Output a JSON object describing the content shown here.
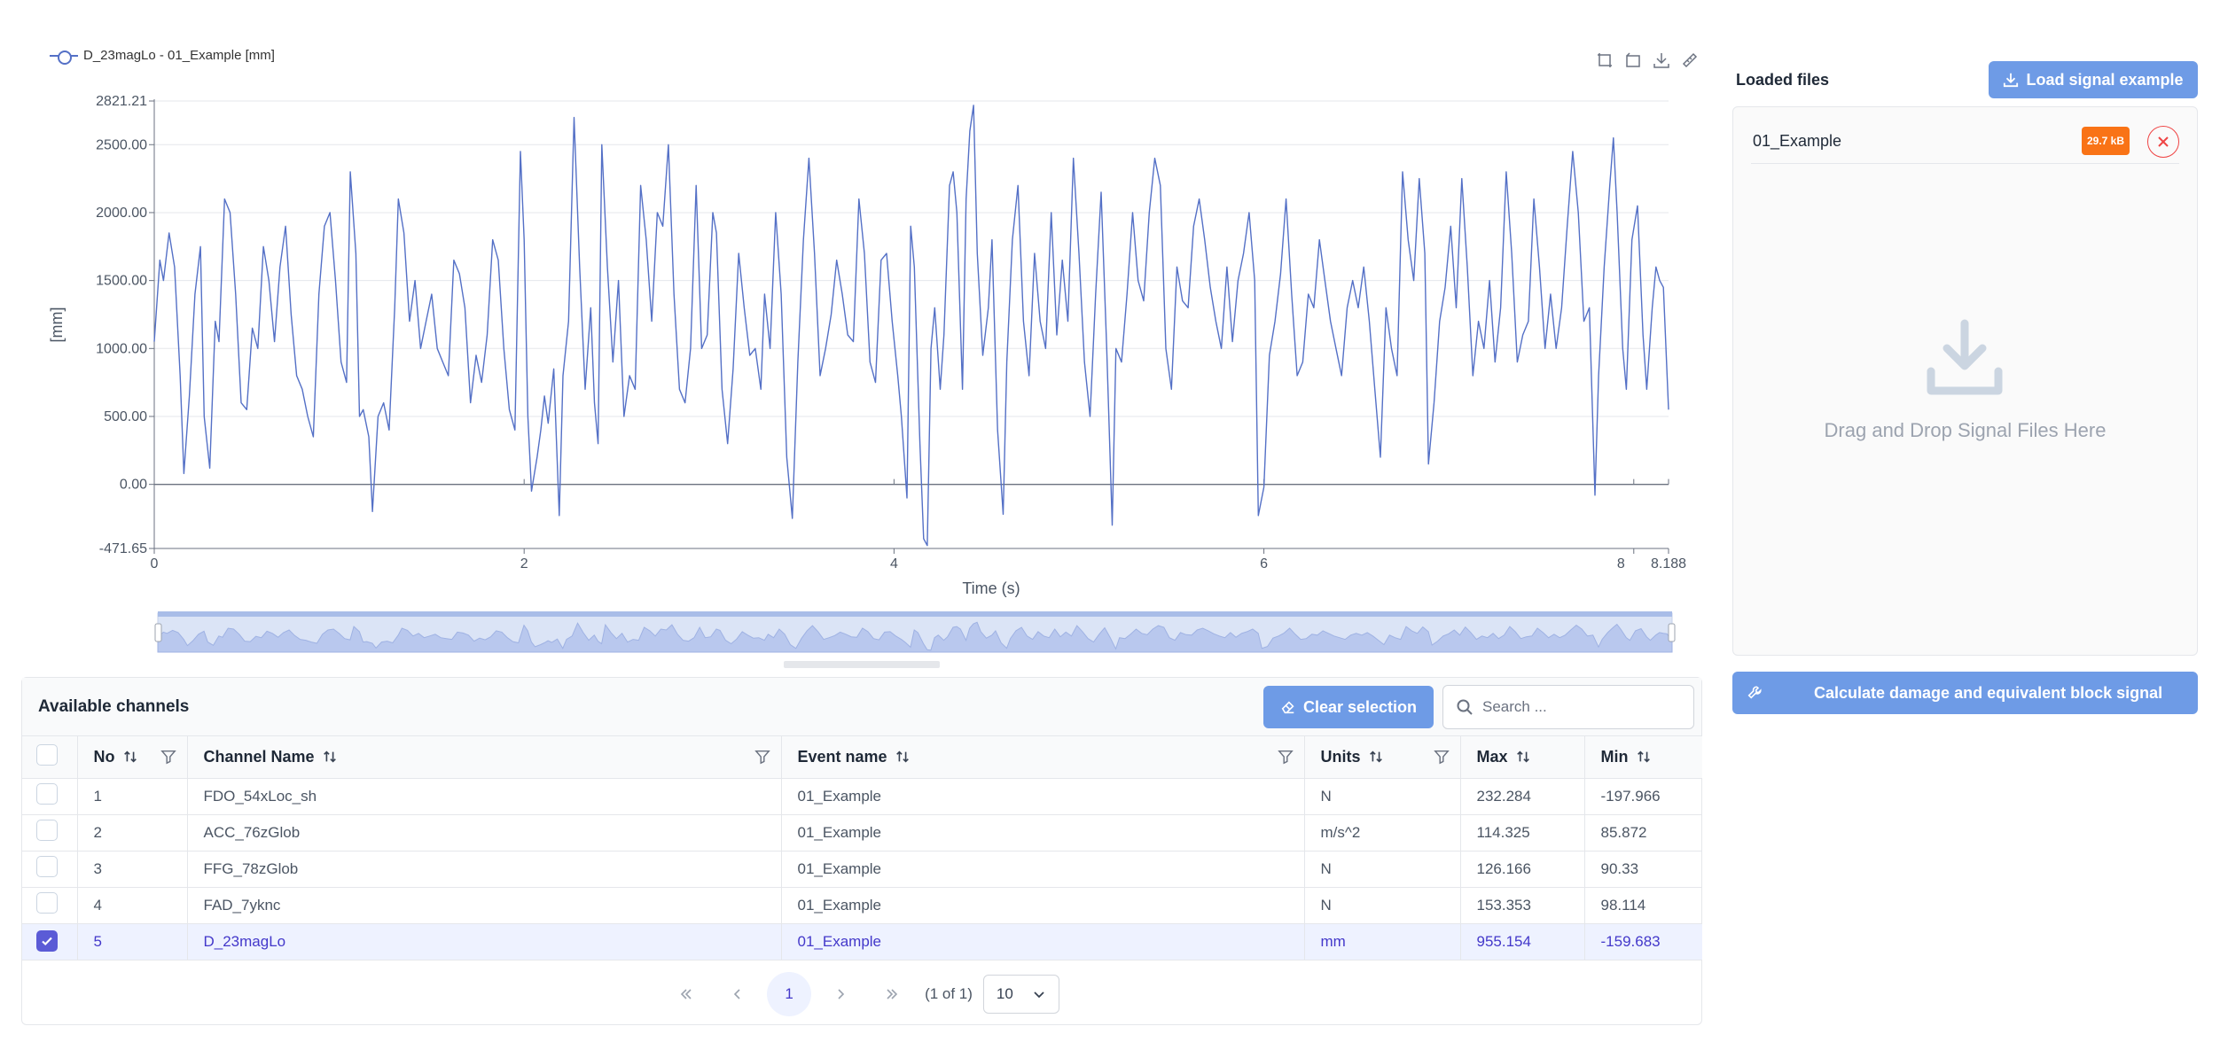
{
  "chart": {
    "legend_label": "D_23magLo - 01_Example [mm]"
  },
  "chart_data": {
    "type": "line",
    "series": [
      {
        "name": "D_23magLo - 01_Example [mm]"
      }
    ],
    "xlabel": "Time (s)",
    "ylabel": "[mm]",
    "xlim": [
      0,
      8.188
    ],
    "ylim": [
      -471.65,
      2821.21
    ],
    "x_ticks": [
      "0",
      "2",
      "4",
      "6",
      "8",
      "8.188"
    ],
    "y_ticks": [
      "2821.21",
      "2500.00",
      "2000.00",
      "1500.00",
      "1000.00",
      "500.00",
      "0.00",
      "-471.65"
    ],
    "grid": true,
    "legend": "top-left",
    "points": [
      [
        0.0,
        1050
      ],
      [
        0.03,
        1650
      ],
      [
        0.05,
        1500
      ],
      [
        0.08,
        1850
      ],
      [
        0.11,
        1600
      ],
      [
        0.14,
        800
      ],
      [
        0.16,
        80
      ],
      [
        0.19,
        650
      ],
      [
        0.22,
        1400
      ],
      [
        0.25,
        1750
      ],
      [
        0.27,
        500
      ],
      [
        0.3,
        120
      ],
      [
        0.33,
        1200
      ],
      [
        0.35,
        1050
      ],
      [
        0.38,
        2100
      ],
      [
        0.41,
        2000
      ],
      [
        0.44,
        1400
      ],
      [
        0.47,
        600
      ],
      [
        0.5,
        550
      ],
      [
        0.53,
        1150
      ],
      [
        0.56,
        1000
      ],
      [
        0.59,
        1750
      ],
      [
        0.62,
        1500
      ],
      [
        0.65,
        1050
      ],
      [
        0.68,
        1600
      ],
      [
        0.71,
        1900
      ],
      [
        0.74,
        1250
      ],
      [
        0.77,
        800
      ],
      [
        0.8,
        700
      ],
      [
        0.83,
        500
      ],
      [
        0.86,
        350
      ],
      [
        0.89,
        1400
      ],
      [
        0.92,
        1900
      ],
      [
        0.95,
        2000
      ],
      [
        0.98,
        1500
      ],
      [
        1.01,
        900
      ],
      [
        1.04,
        750
      ],
      [
        1.06,
        2300
      ],
      [
        1.09,
        1700
      ],
      [
        1.11,
        500
      ],
      [
        1.13,
        550
      ],
      [
        1.16,
        350
      ],
      [
        1.18,
        -200
      ],
      [
        1.21,
        500
      ],
      [
        1.24,
        600
      ],
      [
        1.27,
        400
      ],
      [
        1.3,
        1300
      ],
      [
        1.32,
        2100
      ],
      [
        1.35,
        1850
      ],
      [
        1.38,
        1200
      ],
      [
        1.41,
        1500
      ],
      [
        1.44,
        1000
      ],
      [
        1.47,
        1200
      ],
      [
        1.5,
        1400
      ],
      [
        1.53,
        1000
      ],
      [
        1.56,
        900
      ],
      [
        1.59,
        800
      ],
      [
        1.62,
        1650
      ],
      [
        1.65,
        1550
      ],
      [
        1.68,
        1300
      ],
      [
        1.71,
        600
      ],
      [
        1.74,
        950
      ],
      [
        1.77,
        750
      ],
      [
        1.8,
        1100
      ],
      [
        1.83,
        1800
      ],
      [
        1.86,
        1650
      ],
      [
        1.89,
        1000
      ],
      [
        1.92,
        550
      ],
      [
        1.95,
        400
      ],
      [
        1.98,
        2450
      ],
      [
        2.0,
        1800
      ],
      [
        2.02,
        500
      ],
      [
        2.04,
        -50
      ],
      [
        2.07,
        200
      ],
      [
        2.09,
        400
      ],
      [
        2.11,
        650
      ],
      [
        2.13,
        450
      ],
      [
        2.16,
        850
      ],
      [
        2.19,
        -230
      ],
      [
        2.21,
        800
      ],
      [
        2.24,
        1200
      ],
      [
        2.27,
        2700
      ],
      [
        2.3,
        1600
      ],
      [
        2.33,
        700
      ],
      [
        2.36,
        1300
      ],
      [
        2.38,
        600
      ],
      [
        2.4,
        300
      ],
      [
        2.42,
        2500
      ],
      [
        2.45,
        1600
      ],
      [
        2.48,
        900
      ],
      [
        2.51,
        1500
      ],
      [
        2.54,
        500
      ],
      [
        2.57,
        800
      ],
      [
        2.6,
        700
      ],
      [
        2.63,
        2200
      ],
      [
        2.66,
        1800
      ],
      [
        2.69,
        1200
      ],
      [
        2.72,
        2000
      ],
      [
        2.75,
        1900
      ],
      [
        2.78,
        2500
      ],
      [
        2.81,
        1400
      ],
      [
        2.84,
        700
      ],
      [
        2.87,
        600
      ],
      [
        2.9,
        1000
      ],
      [
        2.93,
        2200
      ],
      [
        2.96,
        1000
      ],
      [
        2.99,
        1100
      ],
      [
        3.02,
        2000
      ],
      [
        3.04,
        1850
      ],
      [
        3.07,
        700
      ],
      [
        3.1,
        300
      ],
      [
        3.13,
        850
      ],
      [
        3.16,
        1700
      ],
      [
        3.19,
        1300
      ],
      [
        3.22,
        950
      ],
      [
        3.25,
        1000
      ],
      [
        3.28,
        700
      ],
      [
        3.3,
        1400
      ],
      [
        3.33,
        1000
      ],
      [
        3.36,
        2000
      ],
      [
        3.39,
        1400
      ],
      [
        3.42,
        200
      ],
      [
        3.45,
        -250
      ],
      [
        3.48,
        900
      ],
      [
        3.51,
        1800
      ],
      [
        3.54,
        2400
      ],
      [
        3.57,
        1700
      ],
      [
        3.6,
        800
      ],
      [
        3.63,
        1000
      ],
      [
        3.66,
        1250
      ],
      [
        3.69,
        1650
      ],
      [
        3.72,
        1400
      ],
      [
        3.75,
        1100
      ],
      [
        3.78,
        1050
      ],
      [
        3.81,
        2100
      ],
      [
        3.84,
        1700
      ],
      [
        3.87,
        900
      ],
      [
        3.9,
        750
      ],
      [
        3.93,
        1650
      ],
      [
        3.96,
        1700
      ],
      [
        3.99,
        1200
      ],
      [
        4.02,
        800
      ],
      [
        4.04,
        500
      ],
      [
        4.07,
        -100
      ],
      [
        4.09,
        1900
      ],
      [
        4.11,
        1600
      ],
      [
        4.14,
        300
      ],
      [
        4.16,
        -400
      ],
      [
        4.18,
        -450
      ],
      [
        4.2,
        1000
      ],
      [
        4.22,
        1300
      ],
      [
        4.25,
        700
      ],
      [
        4.27,
        1100
      ],
      [
        4.3,
        2200
      ],
      [
        4.32,
        2300
      ],
      [
        4.34,
        2000
      ],
      [
        4.37,
        700
      ],
      [
        4.39,
        2100
      ],
      [
        4.41,
        2600
      ],
      [
        4.43,
        2790
      ],
      [
        4.45,
        1700
      ],
      [
        4.48,
        950
      ],
      [
        4.51,
        1300
      ],
      [
        4.53,
        1800
      ],
      [
        4.56,
        400
      ],
      [
        4.59,
        -220
      ],
      [
        4.61,
        900
      ],
      [
        4.64,
        1800
      ],
      [
        4.67,
        2200
      ],
      [
        4.7,
        1200
      ],
      [
        4.73,
        800
      ],
      [
        4.76,
        1700
      ],
      [
        4.79,
        1200
      ],
      [
        4.82,
        1000
      ],
      [
        4.85,
        2000
      ],
      [
        4.88,
        1100
      ],
      [
        4.91,
        1650
      ],
      [
        4.94,
        1200
      ],
      [
        4.97,
        2400
      ],
      [
        5.0,
        1700
      ],
      [
        5.03,
        900
      ],
      [
        5.06,
        500
      ],
      [
        5.09,
        1400
      ],
      [
        5.12,
        2150
      ],
      [
        5.15,
        1000
      ],
      [
        5.18,
        -300
      ],
      [
        5.2,
        1000
      ],
      [
        5.23,
        900
      ],
      [
        5.26,
        1400
      ],
      [
        5.29,
        2000
      ],
      [
        5.32,
        1500
      ],
      [
        5.35,
        1350
      ],
      [
        5.38,
        2000
      ],
      [
        5.41,
        2400
      ],
      [
        5.44,
        2200
      ],
      [
        5.47,
        1000
      ],
      [
        5.5,
        700
      ],
      [
        5.53,
        1600
      ],
      [
        5.56,
        1350
      ],
      [
        5.59,
        1300
      ],
      [
        5.62,
        1900
      ],
      [
        5.65,
        2100
      ],
      [
        5.68,
        1800
      ],
      [
        5.71,
        1450
      ],
      [
        5.74,
        1200
      ],
      [
        5.77,
        1000
      ],
      [
        5.8,
        1600
      ],
      [
        5.83,
        1050
      ],
      [
        5.86,
        1500
      ],
      [
        5.89,
        1700
      ],
      [
        5.92,
        2000
      ],
      [
        5.95,
        1500
      ],
      [
        5.97,
        -230
      ],
      [
        6.0,
        -20
      ],
      [
        6.03,
        950
      ],
      [
        6.06,
        1200
      ],
      [
        6.09,
        1550
      ],
      [
        6.12,
        2100
      ],
      [
        6.15,
        1400
      ],
      [
        6.18,
        800
      ],
      [
        6.21,
        900
      ],
      [
        6.24,
        1400
      ],
      [
        6.27,
        1300
      ],
      [
        6.3,
        1800
      ],
      [
        6.33,
        1500
      ],
      [
        6.36,
        1200
      ],
      [
        6.39,
        1000
      ],
      [
        6.42,
        800
      ],
      [
        6.45,
        1300
      ],
      [
        6.48,
        1500
      ],
      [
        6.51,
        1300
      ],
      [
        6.54,
        1600
      ],
      [
        6.57,
        1200
      ],
      [
        6.6,
        700
      ],
      [
        6.63,
        200
      ],
      [
        6.66,
        1300
      ],
      [
        6.69,
        1000
      ],
      [
        6.72,
        800
      ],
      [
        6.75,
        2300
      ],
      [
        6.78,
        1800
      ],
      [
        6.81,
        1500
      ],
      [
        6.84,
        2250
      ],
      [
        6.87,
        1700
      ],
      [
        6.89,
        150
      ],
      [
        6.92,
        600
      ],
      [
        6.95,
        1200
      ],
      [
        6.98,
        1450
      ],
      [
        7.01,
        1900
      ],
      [
        7.04,
        1300
      ],
      [
        7.07,
        2250
      ],
      [
        7.1,
        1600
      ],
      [
        7.13,
        800
      ],
      [
        7.16,
        1200
      ],
      [
        7.19,
        1000
      ],
      [
        7.22,
        1500
      ],
      [
        7.25,
        900
      ],
      [
        7.28,
        1300
      ],
      [
        7.31,
        2300
      ],
      [
        7.34,
        1700
      ],
      [
        7.37,
        900
      ],
      [
        7.4,
        1100
      ],
      [
        7.43,
        1200
      ],
      [
        7.46,
        2100
      ],
      [
        7.49,
        1600
      ],
      [
        7.52,
        1000
      ],
      [
        7.55,
        1400
      ],
      [
        7.58,
        1000
      ],
      [
        7.61,
        1300
      ],
      [
        7.64,
        1900
      ],
      [
        7.67,
        2450
      ],
      [
        7.7,
        2000
      ],
      [
        7.73,
        1200
      ],
      [
        7.76,
        1300
      ],
      [
        7.79,
        -80
      ],
      [
        7.81,
        800
      ],
      [
        7.84,
        1600
      ],
      [
        7.87,
        2200
      ],
      [
        7.89,
        2550
      ],
      [
        7.91,
        2000
      ],
      [
        7.94,
        1000
      ],
      [
        7.96,
        700
      ],
      [
        7.99,
        1800
      ],
      [
        8.02,
        2050
      ],
      [
        8.05,
        1100
      ],
      [
        8.07,
        700
      ],
      [
        8.1,
        1300
      ],
      [
        8.12,
        1600
      ],
      [
        8.14,
        1500
      ],
      [
        8.16,
        1450
      ],
      [
        8.188,
        550
      ]
    ]
  },
  "panel": {
    "title": "Loaded files",
    "load_button": "Load signal example",
    "files": [
      {
        "name": "01_Example",
        "size": "29.7 kB"
      }
    ],
    "drop_text": "Drag and Drop Signal Files Here",
    "calc_button": "Calculate damage and equivalent block signal"
  },
  "table": {
    "title": "Available channels",
    "clear_button": "Clear selection",
    "search_placeholder": "Search ...",
    "columns": [
      "No",
      "Channel Name",
      "Event name",
      "Units",
      "Max",
      "Min"
    ],
    "rows": [
      {
        "no": "1",
        "name": "FDO_54xLoc_sh",
        "event": "01_Example",
        "units": "N",
        "max": "232.284",
        "min": "-197.966",
        "selected": false
      },
      {
        "no": "2",
        "name": "ACC_76zGlob",
        "event": "01_Example",
        "units": "m/s^2",
        "max": "114.325",
        "min": "85.872",
        "selected": false
      },
      {
        "no": "3",
        "name": "FFG_78zGlob",
        "event": "01_Example",
        "units": "N",
        "max": "126.166",
        "min": "90.33",
        "selected": false
      },
      {
        "no": "4",
        "name": "FAD_7yknc",
        "event": "01_Example",
        "units": "N",
        "max": "153.353",
        "min": "98.114",
        "selected": false
      },
      {
        "no": "5",
        "name": "D_23magLo",
        "event": "01_Example",
        "units": "mm",
        "max": "955.154",
        "min": "-159.683",
        "selected": true
      }
    ],
    "pager": {
      "current_page": "1",
      "info": "(1 of 1)",
      "page_size": "10"
    }
  },
  "colors": {
    "series": "#5470c6",
    "accent": "#6e9be6",
    "size_badge": "#f97316",
    "remove": "#ef4444",
    "selected_row": "#eef2ff"
  }
}
